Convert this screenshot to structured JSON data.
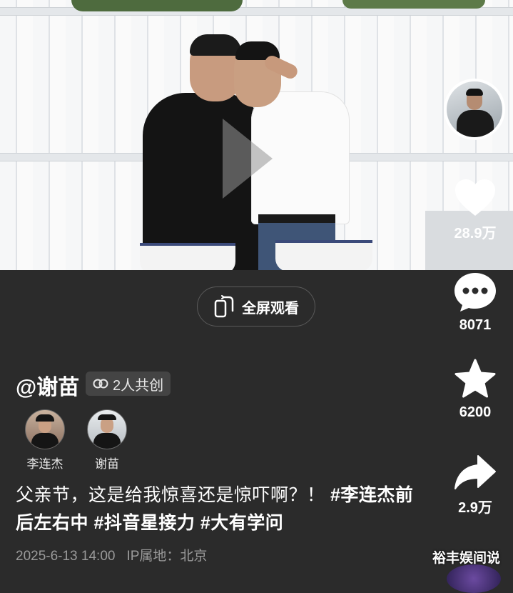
{
  "video": {
    "fullscreen_label": "全屏观看"
  },
  "rail": {
    "like_count": "28.9万",
    "comment_count": "8071",
    "favorite_count": "6200",
    "share_count": "2.9万"
  },
  "author": {
    "handle": "@谢苗",
    "cocreate_label": "2人共创"
  },
  "creators": [
    {
      "name": "李连杰"
    },
    {
      "name": "谢苗"
    }
  ],
  "caption": {
    "text": "父亲节，这是给我惊喜还是惊吓啊？！ ",
    "tags": [
      "#李连杰前后左右中",
      "#抖音星接力",
      "#大有学问"
    ]
  },
  "meta": {
    "datetime": "2025-6-13 14:00",
    "ip_location": "IP属地：北京"
  },
  "watermark": "裕丰娱间说"
}
